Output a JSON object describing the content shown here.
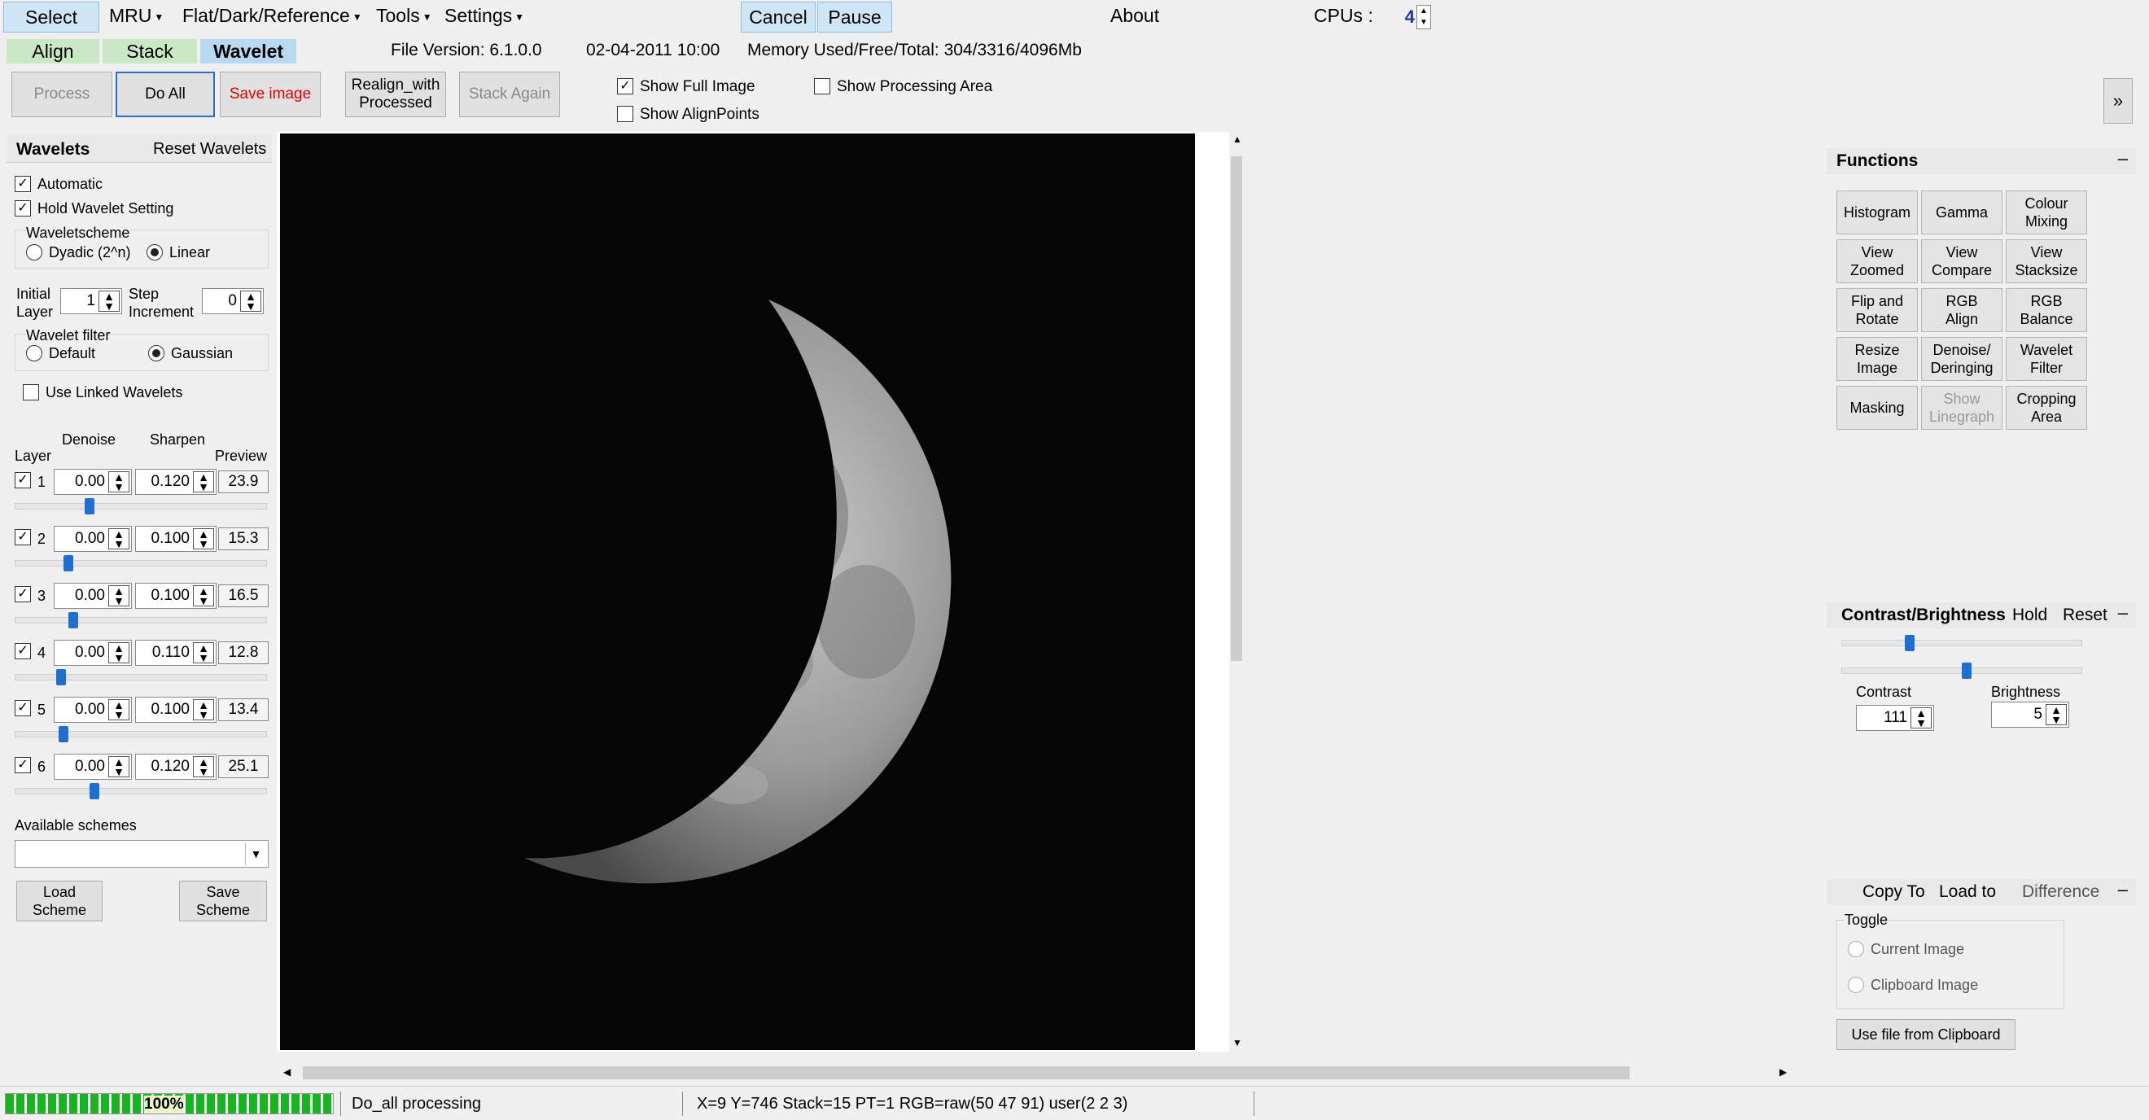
{
  "menu": {
    "select": "Select",
    "mru": "MRU",
    "flat": "Flat/Dark/Reference",
    "tools": "Tools",
    "settings": "Settings",
    "cancel": "Cancel",
    "pause": "Pause",
    "about": "About",
    "cpus_label": "CPUs :",
    "cpus_value": "4"
  },
  "tabs": [
    "Align",
    "Stack",
    "Wavelet"
  ],
  "info": {
    "file_version": "File Version: 6.1.0.0",
    "date": "02-04-2011 10:00",
    "memory": "Memory Used/Free/Total: 304/3316/4096Mb"
  },
  "toolbar": {
    "process": "Process",
    "do_all": "Do All",
    "save_image": "Save image",
    "realign_line1": "Realign_with",
    "realign_line2": "Processed",
    "stack_again": "Stack Again",
    "show_full_image": "Show Full Image",
    "show_align_points": "Show AlignPoints",
    "show_processing_area": "Show Processing Area",
    "expand": "»"
  },
  "wavelets": {
    "title": "Wavelets",
    "reset": "Reset Wavelets",
    "automatic": "Automatic",
    "hold_setting": "Hold Wavelet Setting",
    "scheme_group": "Waveletscheme",
    "dyadic": "Dyadic (2^n)",
    "linear": "Linear",
    "initial_layer_l1": "Initial",
    "initial_layer_l2": "Layer",
    "initial_layer_value": "1",
    "step_l1": "Step",
    "step_l2": "Increment",
    "step_value": "0",
    "filter_group": "Wavelet filter",
    "filter_default": "Default",
    "filter_gaussian": "Gaussian",
    "use_linked": "Use Linked Wavelets",
    "col_layer": "Layer",
    "col_denoise": "Denoise",
    "col_sharpen": "Sharpen",
    "col_preview": "Preview",
    "layers": [
      {
        "num": "1",
        "denoise": "0.00",
        "sharpen": "0.120",
        "preview": "23.9",
        "level": 0.29
      },
      {
        "num": "2",
        "denoise": "0.00",
        "sharpen": "0.100",
        "preview": "15.3",
        "level": 0.2
      },
      {
        "num": "3",
        "denoise": "0.00",
        "sharpen": "0.100",
        "preview": "16.5",
        "level": 0.22
      },
      {
        "num": "4",
        "denoise": "0.00",
        "sharpen": "0.110",
        "preview": "12.8",
        "level": 0.17
      },
      {
        "num": "5",
        "denoise": "0.00",
        "sharpen": "0.100",
        "preview": "13.4",
        "level": 0.18
      },
      {
        "num": "6",
        "denoise": "0.00",
        "sharpen": "0.120",
        "preview": "25.1",
        "level": 0.31
      }
    ],
    "available_schemes": "Available schemes",
    "load_l1": "Load",
    "load_l2": "Scheme",
    "save_l1": "Save",
    "save_l2": "Scheme"
  },
  "functions": {
    "title": "Functions",
    "buttons": [
      [
        "Histogram"
      ],
      [
        "Gamma"
      ],
      [
        "Colour",
        "Mixing"
      ],
      [
        "View",
        "Zoomed"
      ],
      [
        "View",
        "Compare"
      ],
      [
        "View",
        "Stacksize"
      ],
      [
        "Flip and",
        "Rotate"
      ],
      [
        "RGB",
        "Align"
      ],
      [
        "RGB",
        "Balance"
      ],
      [
        "Resize",
        "Image"
      ],
      [
        "Denoise/",
        "Deringing"
      ],
      [
        "Wavelet",
        "Filter"
      ],
      [
        "Masking"
      ],
      [
        "Show",
        "Linegraph"
      ],
      [
        "Cropping",
        "Area"
      ]
    ]
  },
  "contrast": {
    "title": "Contrast/Brightness",
    "hold": "Hold",
    "reset": "Reset",
    "contrast_label": "Contrast",
    "contrast_value": "111",
    "brightness_label": "Brightness",
    "brightness_value": "5"
  },
  "clipboard": {
    "copy_to": "Copy To",
    "load_to": "Load to",
    "difference": "Difference",
    "toggle": "Toggle",
    "current": "Current Image",
    "clipboard_image": "Clipboard Image",
    "use_file": "Use file from Clipboard"
  },
  "status": {
    "progress_text": "100%",
    "progress": 1.0,
    "state": "Do_all processing",
    "coords": "X=9 Y=746 Stack=15 PT=1 RGB=raw(50 47 91) user(2 2 3)"
  },
  "colors": {
    "accent": "#1e6fd0",
    "active_tab": "#b7d9f2",
    "tab": "#cbe8c4",
    "progress": "#17b51f",
    "save_red": "#e00000"
  }
}
